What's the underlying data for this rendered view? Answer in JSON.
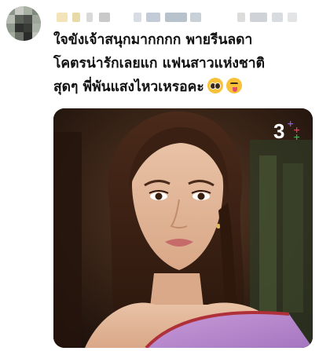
{
  "post": {
    "author": {
      "avatar_icon": "avatar-pixelated-icon",
      "name_obscured": true
    },
    "text_lines": [
      "ใจขังเจ้าสนุกมากกกก พายรีนลดา",
      "โคตรน่ารักเลยแก แฟนสาวแห่งชาติ",
      "สุดๆ พี่พันแสงไหวเหรอคะ"
    ],
    "emojis": [
      "pleading-face-icon",
      "face-with-tongue-icon"
    ],
    "media": {
      "type": "image",
      "channel_logo_text": "3",
      "channel_logo_colors": [
        "#8e5bd6",
        "#e0405a",
        "#37b24d"
      ]
    }
  },
  "colors": {
    "text": "#111111",
    "background": "#ffffff"
  }
}
